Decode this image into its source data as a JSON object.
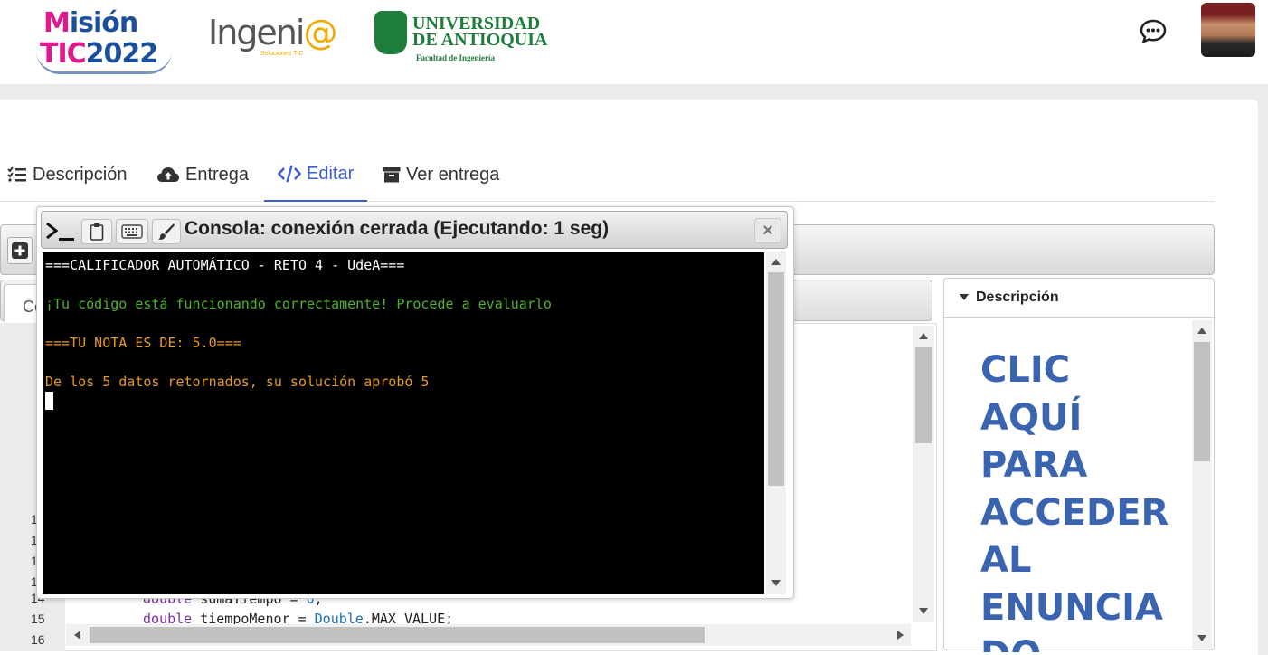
{
  "header": {
    "logo_mision_line1_a": "M",
    "logo_mision_line1_b": "isión",
    "logo_mision_line2_a": "TIC",
    "logo_mision_line2_b": "2022",
    "logo_ingenia_text": "Ingeni",
    "logo_ingenia_at": "@",
    "logo_ingenia_sub": "Soluciones TIC",
    "logo_udea_line1": "UNIVERSIDAD",
    "logo_udea_line2": "DE ANTIOQUIA",
    "logo_udea_line3": "Facultad de Ingeniería"
  },
  "tabs": [
    {
      "label": "Descripción",
      "icon": "list-check-icon"
    },
    {
      "label": "Entrega",
      "icon": "cloud-upload-icon"
    },
    {
      "label": "Editar",
      "icon": "code-icon"
    },
    {
      "label": "Ver entrega",
      "icon": "archive-box-icon"
    }
  ],
  "active_tab": "Editar",
  "editor": {
    "file_tab_label": "Co",
    "line_numbers": [
      "1",
      "1",
      "1",
      "1",
      "14",
      "15",
      "16"
    ],
    "code_lines": [
      {
        "kw": "double",
        "rest": " sumaTiempo = ",
        "num": "0",
        "end": ";"
      },
      {
        "kw": "double",
        "rest": " tiempoMenor = ",
        "cls": "Double",
        "end": ".MAX_VALUE;"
      }
    ]
  },
  "description_panel": {
    "header": "Descripción",
    "lines": [
      "CLIC",
      "AQUÍ",
      "PARA",
      "ACCEDER",
      "AL",
      "ENUNCIA",
      "DO"
    ]
  },
  "console": {
    "title": "Consola: conexión cerrada (Ejecutando: 1 seg)",
    "close_label": "×",
    "output": [
      {
        "text": "===CALIFICADOR AUTOMÁTICO - RETO 4 - UdeA===",
        "color": "#ffffff"
      },
      {
        "text": "¡Tu código está funcionando correctamente! Procede a evaluarlo",
        "color": "#4fb32a"
      },
      {
        "text": "===TU NOTA ES DE: 5.0===",
        "color": "#e89a1a"
      },
      {
        "text": "De los 5 datos retornados, su solución aprobó 5",
        "color": "#e89a1a"
      }
    ]
  },
  "colors": {
    "accent": "#3b5fd1",
    "brand_green": "#1e7d3a",
    "description_text": "#3b64b0"
  }
}
